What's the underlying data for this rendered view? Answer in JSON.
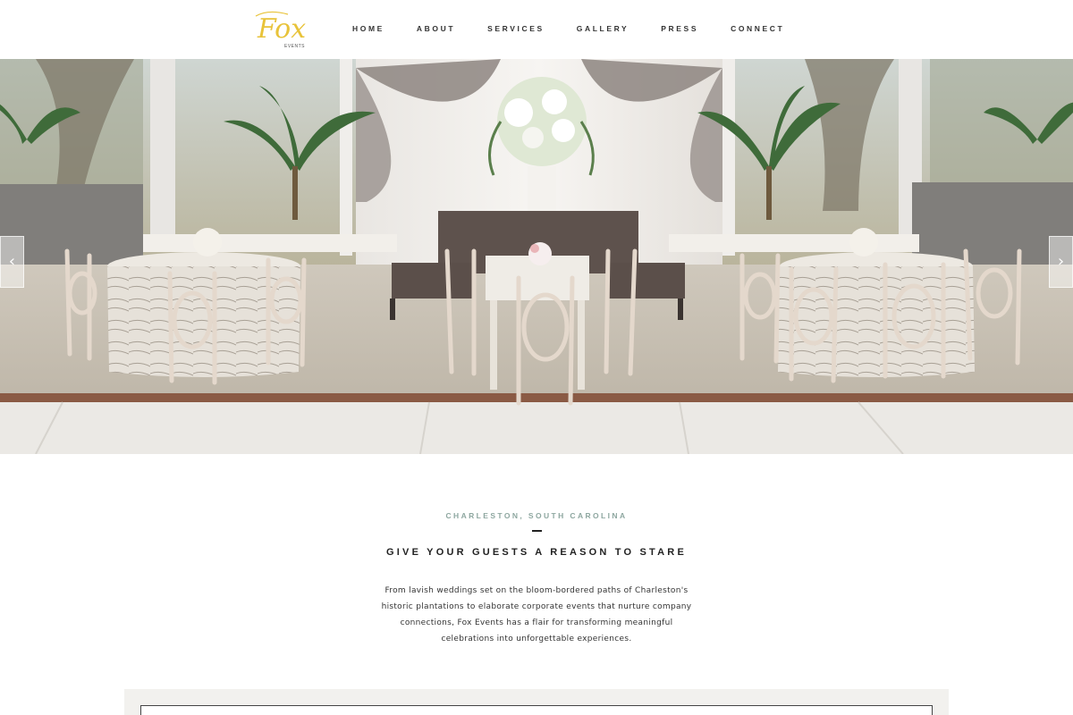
{
  "brand": {
    "logo_script": "Fox",
    "logo_sub": "EVENTS",
    "logo_color": "#e8c33a"
  },
  "nav": {
    "items": [
      {
        "label": "HOME"
      },
      {
        "label": "ABOUT"
      },
      {
        "label": "SERVICES"
      },
      {
        "label": "GALLERY"
      },
      {
        "label": "PRESS"
      },
      {
        "label": "CONNECT"
      }
    ]
  },
  "hero": {
    "prev_icon": "chevron-left-icon",
    "next_icon": "chevron-right-icon",
    "prev_glyph": "‹",
    "next_glyph": "›"
  },
  "intro": {
    "eyebrow": "CHARLESTON, SOUTH CAROLINA",
    "headline": "GIVE YOUR GUESTS A REASON TO STARE",
    "body": "From lavish weddings set on the bloom-bordered paths of Charleston's historic plantations to elaborate corporate events that nurture company connections, Fox Events has a flair for transforming meaningful celebrations into unforgettable experiences."
  },
  "colors": {
    "accent_teal": "#8ea7a0",
    "band": "#f2f1ee"
  }
}
